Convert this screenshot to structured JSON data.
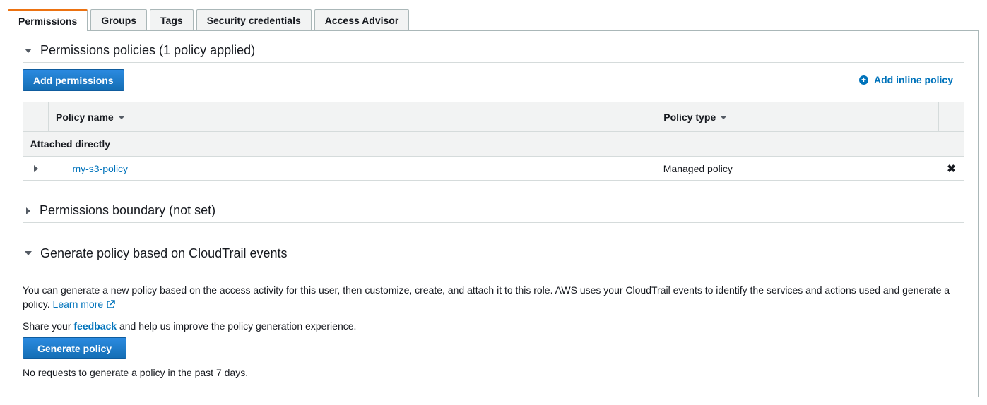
{
  "tabs": [
    {
      "label": "Permissions"
    },
    {
      "label": "Groups"
    },
    {
      "label": "Tags"
    },
    {
      "label": "Security credentials"
    },
    {
      "label": "Access Advisor"
    }
  ],
  "permissions_policies": {
    "title": "Permissions policies (1 policy applied)",
    "add_button": "Add permissions",
    "inline_link": "Add inline policy",
    "columns": {
      "name": "Policy name",
      "type": "Policy type"
    },
    "group_label": "Attached directly",
    "rows": [
      {
        "name": "my-s3-policy",
        "type": "Managed policy"
      }
    ]
  },
  "boundary": {
    "title": "Permissions boundary (not set)"
  },
  "generate": {
    "title": "Generate policy based on CloudTrail events",
    "description": "You can generate a new policy based on the access activity for this user, then customize, create, and attach it to this role. AWS uses your CloudTrail events to identify the services and actions used and generate a policy.",
    "learn_more": "Learn more",
    "feedback_prefix": "Share your",
    "feedback_link": "feedback",
    "feedback_suffix": "and help us improve the policy generation experience.",
    "button": "Generate policy",
    "status": "No requests to generate a policy in the past 7 days."
  },
  "colors": {
    "accent": "#ec7211",
    "link": "#0073bb",
    "button": "#146eb4"
  }
}
